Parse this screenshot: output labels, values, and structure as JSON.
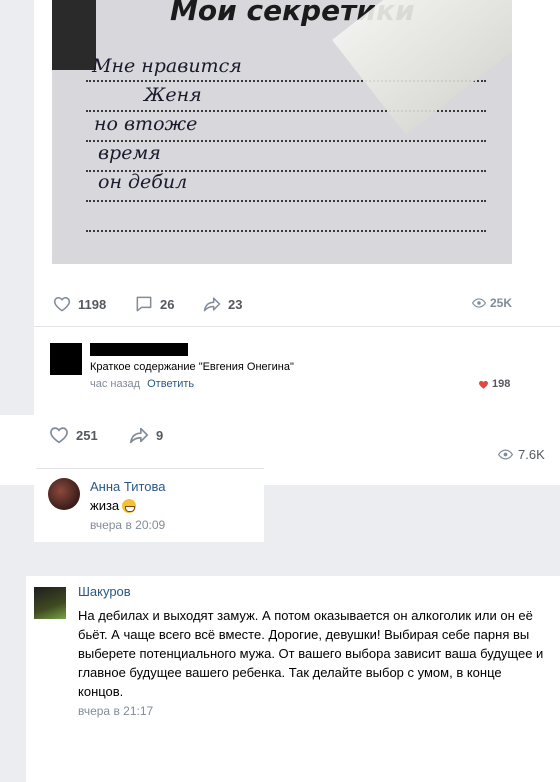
{
  "post": {
    "image": {
      "title": "Мои секретики",
      "handwriting": [
        "Мне нравится",
        "Женя",
        "но втоже",
        "время",
        "он дебил"
      ]
    },
    "likes": "1198",
    "comments": "26",
    "shares": "23",
    "views": "25K"
  },
  "top_comment": {
    "text": "Краткое содержание \"Евгения Онегина\"",
    "time": "час назад",
    "reply_label": "Ответить",
    "likes": "198"
  },
  "post2": {
    "likes": "251",
    "shares": "9",
    "views": "7.6K"
  },
  "comments": [
    {
      "author": "Анна Титова",
      "text": "жиза",
      "time": "вчера в 20:09"
    },
    {
      "author": "Шакуров",
      "text": "На дебилах и выходят замуж. А потом оказывается он алкоголик или он её бьёт. А чаще всего всё вместе. Дорогие, девушки! Выбирая себе парня вы выберете потенциального мужа. От вашего выбора зависит ваша будущее и главное будущее вашего ребенка. Так делайте выбор с умом, в конце концов.",
      "time": "вчера в 21:17"
    }
  ],
  "colors": {
    "link": "#2a5885",
    "meta": "#818c99",
    "heart_red": "#e64646",
    "background": "#ecedf0"
  }
}
